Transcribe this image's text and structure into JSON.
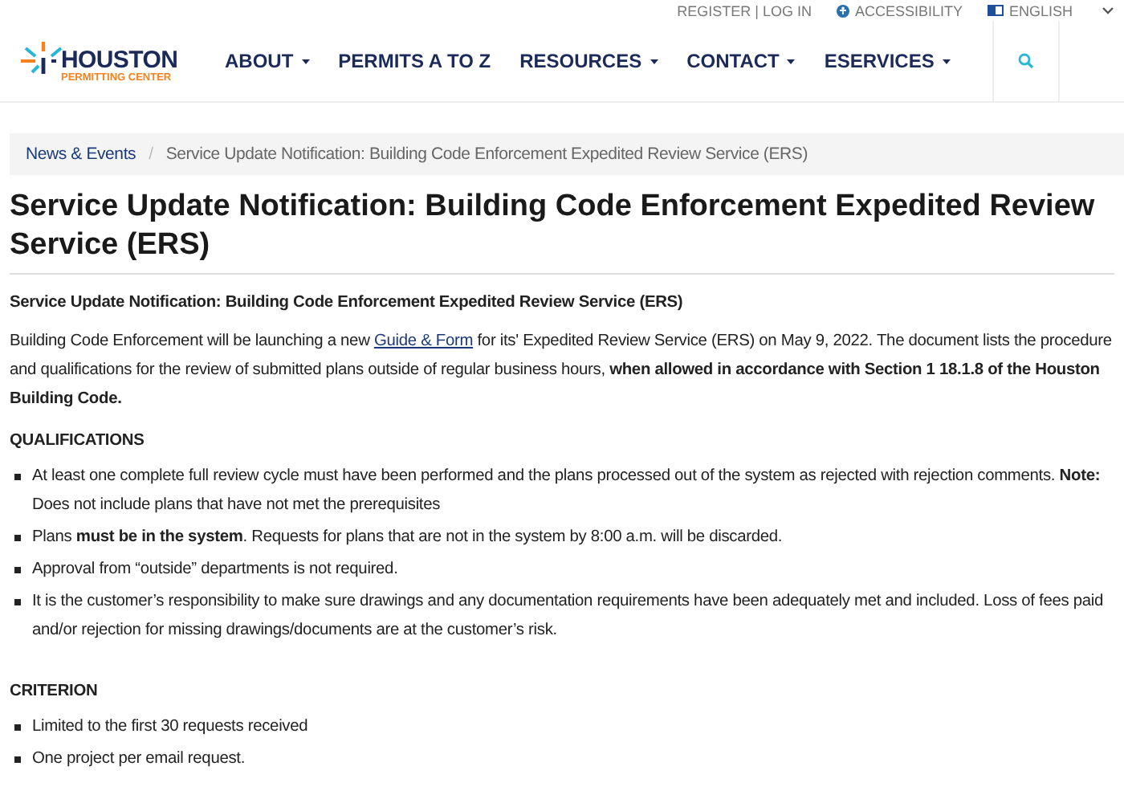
{
  "utility_bar": {
    "account": "REGISTER | LOG IN",
    "accessibility": "ACCESSIBILITY",
    "language": "ENGLISH"
  },
  "logo": {
    "name": "HOUSTON",
    "tagline": "PERMITTING CENTER"
  },
  "nav": [
    {
      "label": "ABOUT",
      "has_menu": true
    },
    {
      "label": "PERMITS A TO Z",
      "has_menu": false
    },
    {
      "label": "RESOURCES",
      "has_menu": true
    },
    {
      "label": "CONTACT",
      "has_menu": true
    },
    {
      "label": "ESERVICES",
      "has_menu": true
    }
  ],
  "breadcrumb_separator": "/",
  "breadcrumb": [
    {
      "label": "News & Events",
      "kind": "link"
    },
    {
      "label": "Service Update Notification: Building Code Enforcement Expedited Review Service (ERS)",
      "kind": "current"
    }
  ],
  "title": "Service Update Notification: Building Code Enforcement Expedited Review Service (ERS)",
  "subtitle": "Service Update Notification: Building Code Enforcement Expedited Review Service (ERS)",
  "intro": {
    "before": "Building Code Enforcement will be launching a new",
    "link": "Guide & Form",
    "after": "for its' Expedited Review Service (ERS) on May 9, 2022. The document lists the procedure and qualifications for the review of submitted plans outside of regular business hours, **when allowed in accordance with Section 1 18.1.8 of the Houston Building Code.**"
  },
  "sections": [
    {
      "heading": "QUALIFICATIONS",
      "items": [
        "At least one complete full review cycle must have been performed and the plans processed out of the system as rejected with rejection comments. **Note:** Does not include plans that have not met the prerequisites",
        "Plans **must be in the system**. Requests for plans that are not in the system by 8:00 a.m. will be discarded.",
        "Approval from “outside” departments is not required.",
        "It is the customer’s responsibility to make sure drawings and any documentation requirements have been adequately met and included. Loss of fees paid and/or rejection for missing drawings/documents are at the customer’s risk."
      ]
    },
    {
      "heading": "CRITERION",
      "items": [
        "Limited to the first 30 requests received",
        "One project per email request."
      ]
    }
  ]
}
